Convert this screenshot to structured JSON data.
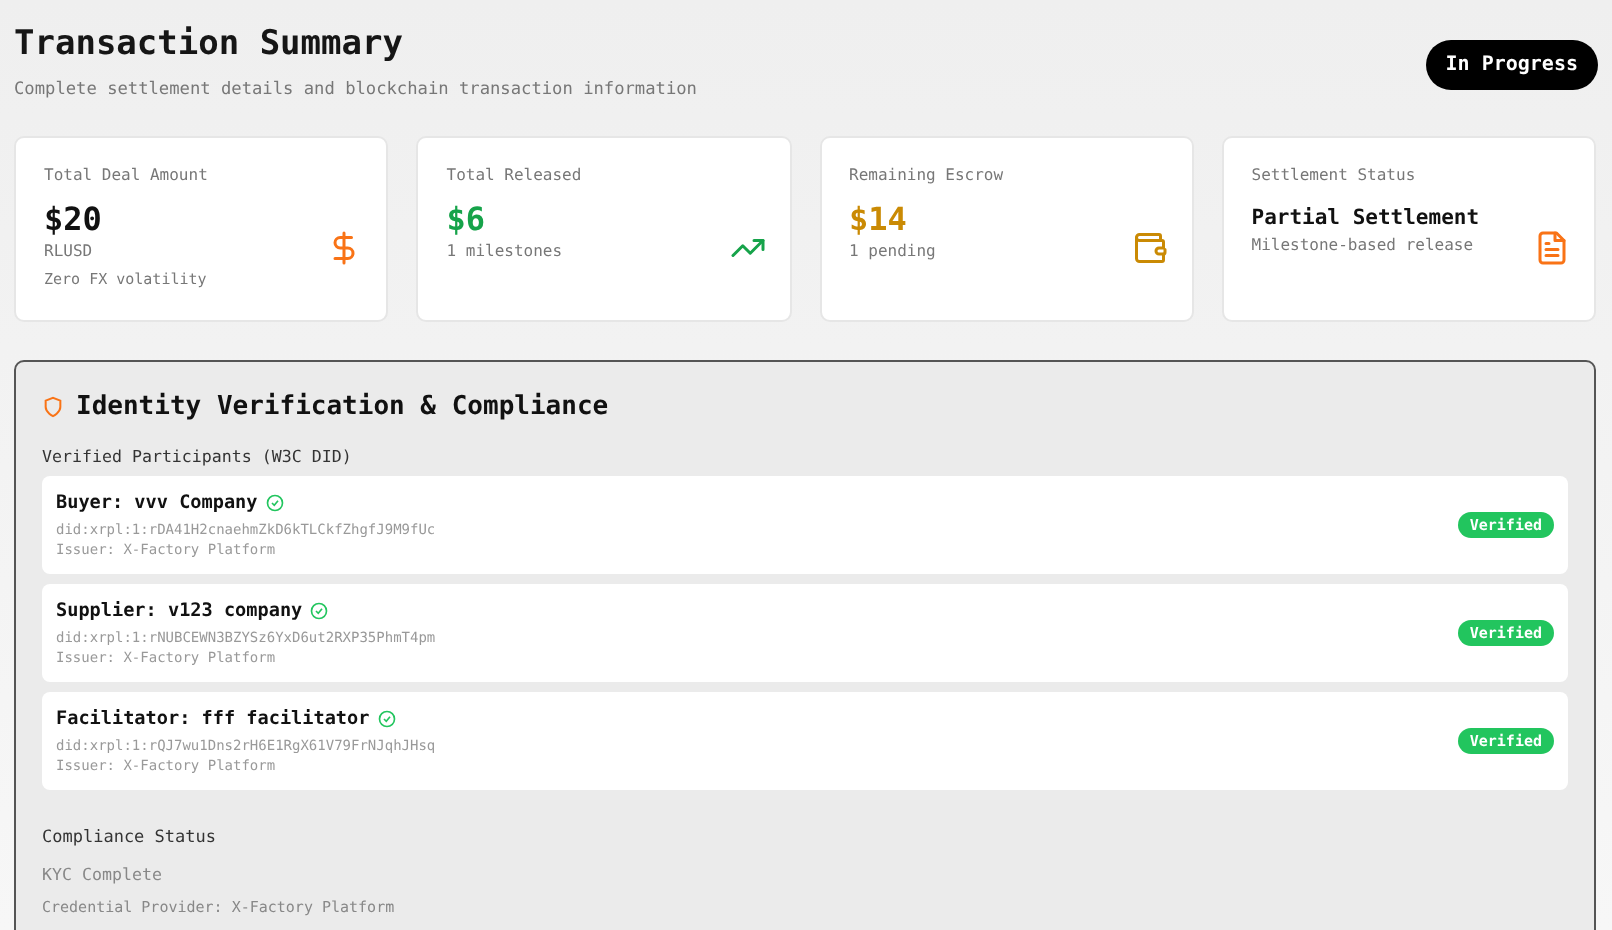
{
  "header": {
    "title": "Transaction Summary",
    "subtitle": "Complete settlement details and blockchain transaction information",
    "status": "In Progress"
  },
  "cards": [
    {
      "label": "Total Deal Amount",
      "value": "$20",
      "lines": [
        "RLUSD",
        "Zero FX volatility"
      ],
      "kind": "amount"
    },
    {
      "label": "Total Released",
      "value": "$6",
      "lines": [
        "1 milestones"
      ],
      "kind": "amount"
    },
    {
      "label": "Remaining Escrow",
      "value": "$14",
      "lines": [
        "1 pending"
      ],
      "kind": "amount"
    },
    {
      "label": "Settlement Status",
      "value": "Partial Settlement",
      "lines": [
        "Milestone-based release"
      ],
      "kind": "status"
    }
  ],
  "identity": {
    "title": "Identity Verification & Compliance",
    "participants_heading": "Verified Participants (W3C DID)",
    "participants": [
      {
        "name": "Buyer: vvv Company",
        "did": "did:xrpl:1:rDA41H2cnaehmZkD6kTLCkfZhgfJ9M9fUc",
        "issuer": "Issuer: X-Factory Platform",
        "verified": true,
        "badge": "Verified"
      },
      {
        "name": "Supplier: v123 company",
        "did": "did:xrpl:1:rNUBCEWN3BZYSz6YxD6ut2RXP35PhmT4pm",
        "issuer": "Issuer: X-Factory Platform",
        "verified": true,
        "badge": "Verified"
      },
      {
        "name": "Facilitator: fff facilitator",
        "did": "did:xrpl:1:rQJ7wu1Dns2rH6E1RgX61V79FrNJqhJHsq",
        "issuer": "Issuer: X-Factory Platform",
        "verified": true,
        "badge": "Verified"
      }
    ],
    "compliance_heading": "Compliance Status",
    "kyc": "KYC Complete",
    "provider": "Credential Provider: X-Factory Platform"
  }
}
